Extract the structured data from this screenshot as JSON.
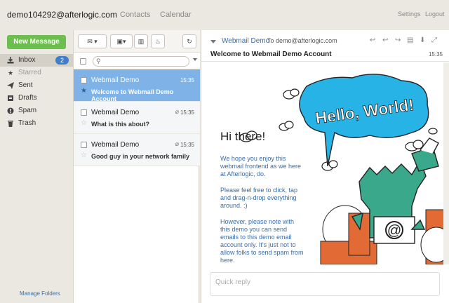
{
  "header": {
    "account": "demo104292@afterlogic.com",
    "nav": [
      "Contacts",
      "Calendar"
    ],
    "settings": "Settings",
    "logout": "Logout"
  },
  "sidebar": {
    "new_message": "New Message",
    "folders": [
      {
        "label": "Inbox",
        "icon": "inbox-icon",
        "count": "2"
      },
      {
        "label": "Starred",
        "icon": "star-icon"
      },
      {
        "label": "Sent",
        "icon": "send-icon"
      },
      {
        "label": "Drafts",
        "icon": "drafts-icon"
      },
      {
        "label": "Spam",
        "icon": "spam-icon"
      },
      {
        "label": "Trash",
        "icon": "trash-icon"
      }
    ],
    "manage_folders": "Manage Folders"
  },
  "list": {
    "search_placeholder": "",
    "messages": [
      {
        "from": "Webmail Demo",
        "subject": "Welcome to Webmail Demo Account",
        "time": "15:35",
        "selected": true
      },
      {
        "from": "Webmail Demo",
        "subject": "What is this about?",
        "time": "15:35"
      },
      {
        "from": "Webmail Demo",
        "subject": "Good guy in your network family",
        "time": "15:35"
      }
    ]
  },
  "reader": {
    "sender": "Webmail Demo",
    "to": "To demo@afterlogic.com",
    "subject": "Welcome to Webmail Demo Account",
    "time": "15:35",
    "greeting": "Hi there!",
    "para1": "We hope you enjoy this webmail frontend as we here at Afterlogic, do.",
    "para2": "Please feel free to click, tap and drag-n-drop everything around. :)",
    "para3": "However, please note with this demo you can send emails to this demo email account only. It's just not to allow folks to send spam from here.",
    "bubble_text": "Hello, World!",
    "mascot_symbol": "@",
    "quick_reply_placeholder": "Quick reply"
  },
  "colors": {
    "accent_green": "#6cbf4f",
    "selected_blue": "#7fb3e8",
    "link_blue": "#3a6da6",
    "bubble_cyan": "#27b3e6",
    "mascot_green": "#3aa88a"
  }
}
